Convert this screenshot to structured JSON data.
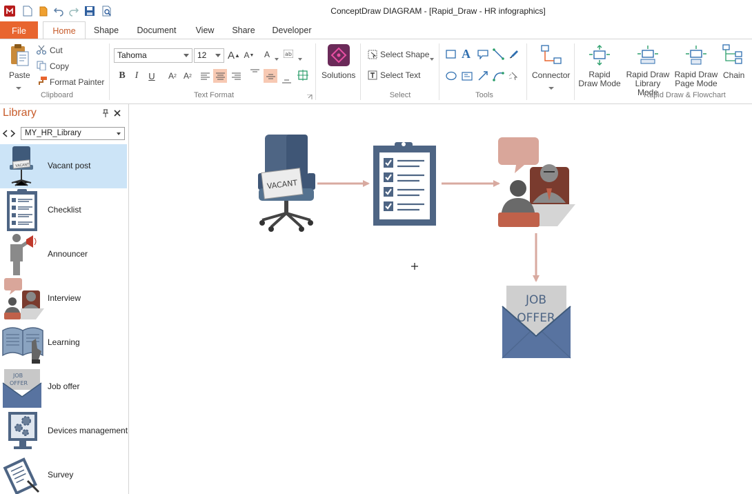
{
  "window": {
    "title": "ConceptDraw DIAGRAM - [Rapid_Draw - HR infographics]"
  },
  "tabs": {
    "file": "File",
    "items": [
      "Home",
      "Shape",
      "Document",
      "View",
      "Share",
      "Developer"
    ],
    "active": "Home"
  },
  "ribbon": {
    "clipboard": {
      "paste": "Paste",
      "cut": "Cut",
      "copy": "Copy",
      "format_painter": "Format Painter",
      "group": "Clipboard"
    },
    "text_format": {
      "font": "Tahoma",
      "size": "12",
      "group": "Text Format"
    },
    "solutions": {
      "label": "Solutions"
    },
    "select": {
      "select_shape": "Select Shape",
      "select_text": "Select Text",
      "group": "Select"
    },
    "tools": {
      "group": "Tools"
    },
    "connector": {
      "label": "Connector"
    },
    "rapid": {
      "draw_mode_1": "Rapid",
      "draw_mode_2": "Draw Mode",
      "library_mode_1": "Rapid Draw",
      "library_mode_2": "Library Mode",
      "page_mode_1": "Rapid Draw",
      "page_mode_2": "Page Mode",
      "chain": "Chain",
      "group": "Rapid Draw & Flowchart"
    }
  },
  "library": {
    "title": "Library",
    "selected": "MY_HR_Library",
    "items": [
      {
        "label": "Vacant post",
        "icon": "vacant-chair-icon"
      },
      {
        "label": "Checklist",
        "icon": "checklist-icon"
      },
      {
        "label": "Announcer",
        "icon": "announcer-icon"
      },
      {
        "label": "Interview",
        "icon": "interview-icon"
      },
      {
        "label": "Learning",
        "icon": "learning-book-icon"
      },
      {
        "label": "Job offer",
        "icon": "job-offer-envelope-icon"
      },
      {
        "label": "Devices management",
        "icon": "devices-gears-icon"
      },
      {
        "label": "Survey",
        "icon": "survey-clipboard-icon"
      }
    ]
  },
  "canvas": {
    "vacant_sign": "VACANT",
    "job_offer_line1": "JOB",
    "job_offer_line2": "OFFER"
  },
  "colors": {
    "accent": "#e8652f",
    "selected_item": "#cce4f7",
    "arrow": "#d8aaa0",
    "navy": "#4e6584",
    "salmon": "#d9a69a"
  }
}
